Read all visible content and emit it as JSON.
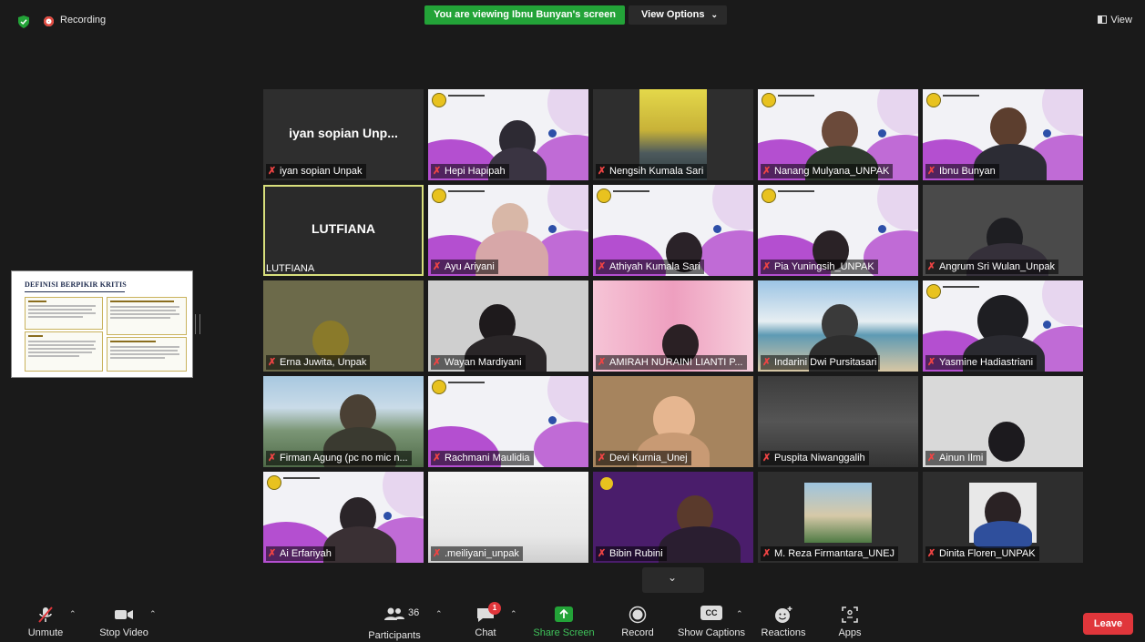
{
  "topbar": {
    "recording": "Recording",
    "viewing_banner": "You are viewing Ibnu Bunyan's screen",
    "view_options": "View Options",
    "view": "View"
  },
  "shared_slide": {
    "title": "DEFINISI BERPIKIR KRITIS"
  },
  "tiles": [
    {
      "name": "iyan sopian Unpak",
      "big_name": "iyan sopian Unp...",
      "muted": true
    },
    {
      "name": "Hepi Hapipah",
      "muted": true
    },
    {
      "name": "Nengsih Kumala Sari",
      "muted": true
    },
    {
      "name": "Nanang Mulyana_UNPAK",
      "muted": true
    },
    {
      "name": "Ibnu Bunyan",
      "muted": true
    },
    {
      "name": "LUTFIANA",
      "big_name": "LUTFIANA",
      "muted": false,
      "active": true
    },
    {
      "name": "Ayu Ariyani",
      "muted": true
    },
    {
      "name": "Athiyah Kumala Sari",
      "muted": true
    },
    {
      "name": "Pia Yuningsih_UNPAK",
      "muted": true
    },
    {
      "name": "Angrum Sri Wulan_Unpak",
      "muted": true
    },
    {
      "name": "Erna Juwita, Unpak",
      "muted": true
    },
    {
      "name": "Wayan Mardiyani",
      "muted": true
    },
    {
      "name": "AMIRAH NURAINI LIANTI P...",
      "muted": true
    },
    {
      "name": "Indarini Dwi Pursitasari",
      "muted": true
    },
    {
      "name": "Yasmine Hadiastriani",
      "muted": true
    },
    {
      "name": "Firman Agung (pc no mic n...",
      "muted": true
    },
    {
      "name": "Rachmani Maulidia",
      "muted": true
    },
    {
      "name": "Devi Kurnia_Unej",
      "muted": true
    },
    {
      "name": "Puspita Niwanggalih",
      "muted": true
    },
    {
      "name": "Ainun Ilmi",
      "muted": true
    },
    {
      "name": "Ai Erfariyah",
      "muted": true
    },
    {
      "name": ".meiliyani_unpak",
      "muted": true
    },
    {
      "name": "Bibin Rubini",
      "muted": true
    },
    {
      "name": "M. Reza Firmantara_UNEJ",
      "muted": true
    },
    {
      "name": "Dinita Floren_UNPAK",
      "muted": true
    }
  ],
  "toolbar": {
    "unmute": "Unmute",
    "stop_video": "Stop Video",
    "participants": "Participants",
    "participants_count": "36",
    "chat": "Chat",
    "chat_badge": "1",
    "share_screen": "Share Screen",
    "record": "Record",
    "show_captions": "Show Captions",
    "cc": "CC",
    "reactions": "Reactions",
    "apps": "Apps",
    "leave": "Leave"
  },
  "colors": {
    "accent_green": "#23a338",
    "leave_red": "#e0363b",
    "active_speaker": "#d8df7c",
    "muted_mic": "#ef4444"
  }
}
